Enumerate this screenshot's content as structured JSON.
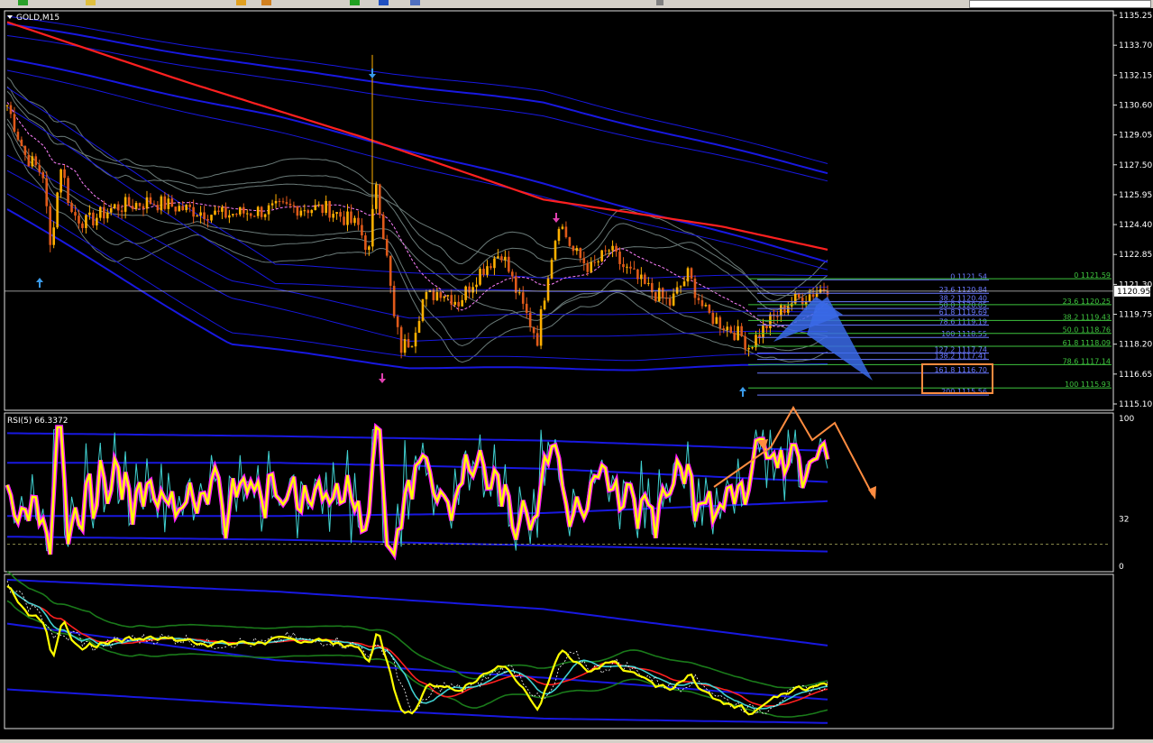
{
  "symbol_header": "GOLD,M15",
  "rsi_header": "RSI(5) 66.3372",
  "colors": {
    "background": "#000000",
    "bull": "#ffb000",
    "bear": "#e05a1a",
    "red_ma": "#ff2020",
    "blue_band": "#1818e0",
    "grey_band": "#6a7a78",
    "rsi_line": "#ffff00",
    "rsi_shadow": "#ff20ff",
    "cyan": "#40d0d0",
    "arrow_up": "#3a9ae8",
    "arrow_down": "#e040b0",
    "orange_annot": "#ff8c40",
    "fib_blue": "#6a78ff",
    "fib_green": "#3ec43e",
    "harmonic_fill": "#3a6ae8"
  },
  "price_axis": {
    "ticks": [
      "1135.25",
      "1133.70",
      "1132.15",
      "1130.60",
      "1129.05",
      "1127.50",
      "1125.95",
      "1124.40",
      "1122.85",
      "1121.30",
      "1119.75",
      "1118.20",
      "1116.65",
      "1115.10"
    ],
    "current": "1120.95",
    "ylim": [
      1115.1,
      1135.25
    ]
  },
  "rsi_axis": {
    "ticks": [
      "100",
      "32",
      "0"
    ]
  },
  "fib_left": [
    {
      "label": "0 1121.54",
      "price": 1121.54
    },
    {
      "label": "23.6 1120.84",
      "price": 1120.84
    },
    {
      "label": "38.2 1120.40",
      "price": 1120.4
    },
    {
      "label": "50.0 1120.05",
      "price": 1120.05
    },
    {
      "label": "61.8 1119.69",
      "price": 1119.69
    },
    {
      "label": "78.6 1119.19",
      "price": 1119.19
    },
    {
      "label": "100 1118.55",
      "price": 1118.55
    },
    {
      "label": "127.2 1117.74",
      "price": 1117.74
    },
    {
      "label": "138.2 1117.41",
      "price": 1117.41
    },
    {
      "label": "161.8 1116.70",
      "price": 1116.7
    },
    {
      "label": "200 1115.56",
      "price": 1115.56
    }
  ],
  "fib_right": [
    {
      "label": "0 1121.59",
      "price": 1121.59
    },
    {
      "label": "23.6 1120.25",
      "price": 1120.25
    },
    {
      "label": "38.2 1119.43",
      "price": 1119.43
    },
    {
      "label": "50.0 1118.76",
      "price": 1118.76
    },
    {
      "label": "61.8 1118.09",
      "price": 1118.09
    },
    {
      "label": "78.6 1117.14",
      "price": 1117.14
    },
    {
      "label": "100 1115.93",
      "price": 1115.93
    }
  ]
}
